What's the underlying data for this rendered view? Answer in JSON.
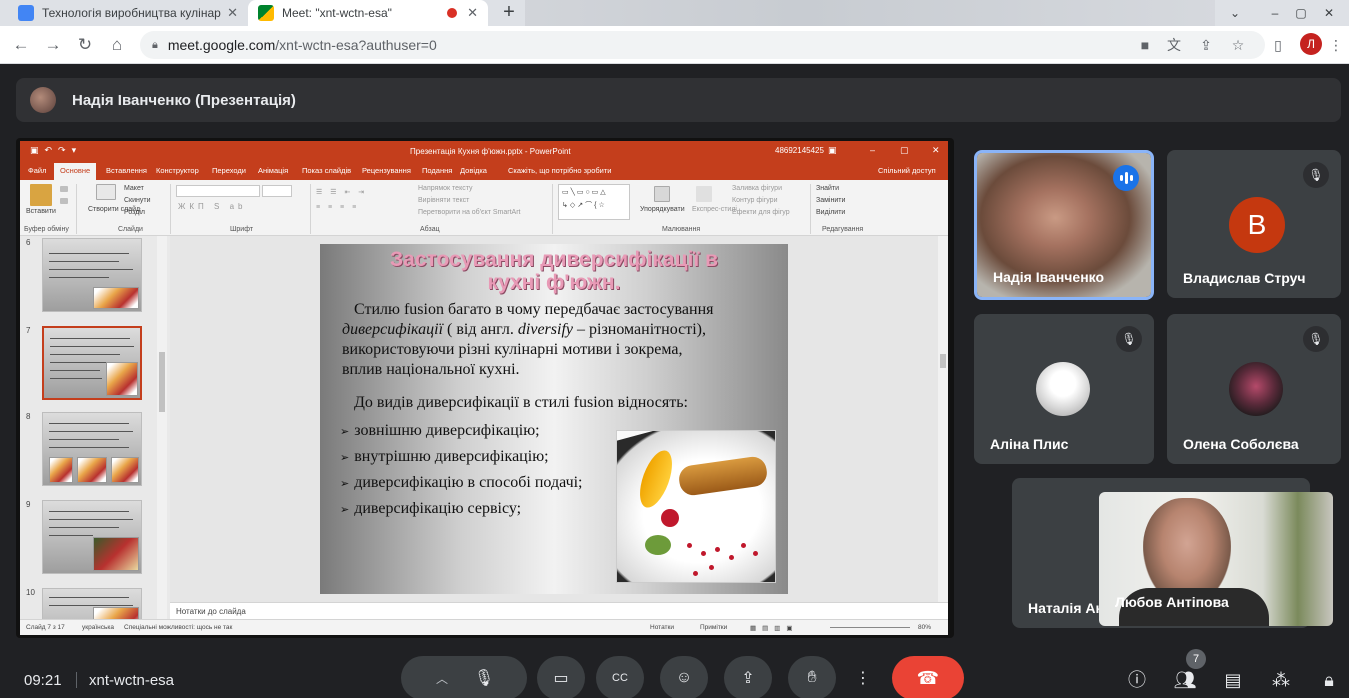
{
  "browser": {
    "tabs": [
      {
        "title": "Технологія виробництва кулінар",
        "active": false
      },
      {
        "title": "Meet: \"xnt-wctn-esa\"",
        "active": true
      }
    ],
    "new_tab_label": "+",
    "url_host": "meet.google.com",
    "url_path": "/xnt-wctn-esa?authuser=0",
    "profile_initial": "Л"
  },
  "meeting": {
    "presenter_title": "Надія Іванченко (Презентація)",
    "time": "09:21",
    "code": "xnt-wctn-esa",
    "participant_count": "7"
  },
  "powerpoint": {
    "window_title": "Презентація Кухня ф'южн.pptx - PowerPoint",
    "account": "48692145425",
    "menu": [
      "Файл",
      "Основне",
      "Вставлення",
      "Конструктор",
      "Переходи",
      "Анімація",
      "Показ слайдів",
      "Рецензування",
      "Подання",
      "Довідка",
      "Скажіть, що потрібно зробити",
      "Спільний доступ"
    ],
    "ribbon": {
      "paste": "Вставити",
      "new_slide": "Створити слайд",
      "layout": "Макет",
      "reset": "Скинути",
      "section": "Розділ",
      "text_direction": "Напрямок тексту",
      "align_text": "Вирівняти текст",
      "smartart": "Перетворити на об'єкт SmartArt",
      "arrange": "Упорядкувати",
      "quick_styles": "Експрес-стилі",
      "shape_fill": "Заливка фігури",
      "shape_outline": "Контур фігури",
      "shape_effects": "Ефекти для фігур",
      "find": "Знайти",
      "replace": "Замінити",
      "select": "Виділити",
      "groups": [
        "Буфер обміну",
        "Слайди",
        "Шрифт",
        "Абзац",
        "Малювання",
        "Редагування"
      ]
    },
    "thumbnail_numbers": [
      "6",
      "7",
      "8",
      "9",
      "10"
    ],
    "slide": {
      "title_line1": "Застосування диверсифікації в",
      "title_line2": "кухні ф'южн.",
      "p1_a": "Стилю fusion багато в чому передбачає застосування",
      "p1_b_italic": "диверсифікації",
      "p1_b": " ( від англ. ",
      "p1_b_italic2": "diversify",
      "p1_b_end": " – різноманітності),",
      "p1_c": "використовуючи різні кулінарні мотиви і зокрема,",
      "p1_d": "вплив національної кухні.",
      "p2": "До видів диверсифікації в стилі fusion відносять:",
      "bullets": [
        "зовнішню диверсифікацію;",
        "внутрішню диверсифікацію;",
        "диверсифікацію в способі подачі;",
        "диверсифікацію сервісу;"
      ]
    },
    "notes_placeholder": "Нотатки до слайда",
    "status": {
      "slide_counter": "Слайд 7 з 17",
      "language": "українська",
      "accessibility": "Спеціальні можливості: щось не так",
      "notes_btn": "Нотатки",
      "comments_btn": "Примітки",
      "zoom": "80%"
    }
  },
  "participants": [
    {
      "name": "Надія Іванченко",
      "speaking": true
    },
    {
      "name": "Владислав Струч",
      "initial": "В",
      "muted": true
    },
    {
      "name": "Аліна Плис",
      "muted": true
    },
    {
      "name": "Олена Соболєва",
      "muted": true
    },
    {
      "name": "Наталія Ан"
    },
    {
      "name": "Любов Антіпова"
    }
  ],
  "colors": {
    "meet_bg": "#202124",
    "tile_bg": "#3c4043",
    "ppt_accent": "#c43e1c",
    "speaking_blue": "#1a73e8",
    "hangup_red": "#ea4335",
    "avatar_orange": "#c5380f"
  }
}
